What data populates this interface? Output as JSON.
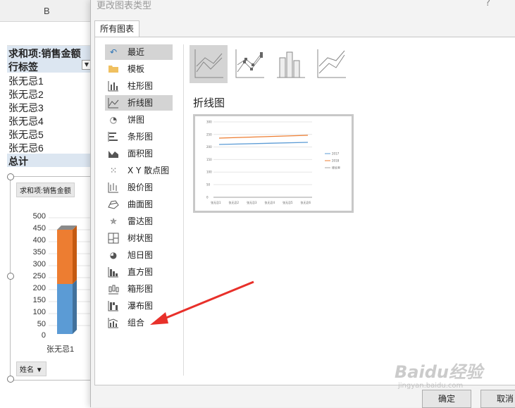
{
  "sheet": {
    "column_header": "B",
    "pivot_title": "求和项:销售金额",
    "row_label": "行标签",
    "rows": [
      "张无忌1",
      "张无忌2",
      "张无忌3",
      "张无忌4",
      "张无忌5",
      "张无忌6"
    ],
    "total": "总计"
  },
  "pivot_chart": {
    "field_button": "求和项:销售金额",
    "axis_button": "姓名",
    "y_ticks": [
      "500",
      "450",
      "400",
      "350",
      "300",
      "250",
      "200",
      "150",
      "100",
      "50",
      "0"
    ],
    "x_label": "张无忌1",
    "x_label_partial": "张",
    "colors": {
      "series1": "#5b9bd5",
      "series2": "#ed7d31"
    }
  },
  "dialog": {
    "title": "更改图表类型",
    "help": "?",
    "tab": "所有图表",
    "categories": [
      {
        "label": "最近",
        "icon": "recent-icon"
      },
      {
        "label": "模板",
        "icon": "folder-icon"
      },
      {
        "label": "柱形图",
        "icon": "column-chart-icon"
      },
      {
        "label": "折线图",
        "icon": "line-chart-icon"
      },
      {
        "label": "饼图",
        "icon": "pie-chart-icon"
      },
      {
        "label": "条形图",
        "icon": "bar-chart-icon"
      },
      {
        "label": "面积图",
        "icon": "area-chart-icon"
      },
      {
        "label": "X Y 散点图",
        "icon": "scatter-chart-icon"
      },
      {
        "label": "股价图",
        "icon": "stock-chart-icon"
      },
      {
        "label": "曲面图",
        "icon": "surface-chart-icon"
      },
      {
        "label": "雷达图",
        "icon": "radar-chart-icon"
      },
      {
        "label": "树状图",
        "icon": "treemap-icon"
      },
      {
        "label": "旭日图",
        "icon": "sunburst-icon"
      },
      {
        "label": "直方图",
        "icon": "histogram-icon"
      },
      {
        "label": "箱形图",
        "icon": "boxplot-icon"
      },
      {
        "label": "瀑布图",
        "icon": "waterfall-icon"
      },
      {
        "label": "组合",
        "icon": "combo-chart-icon"
      }
    ],
    "selected_category": "折线图",
    "preview_title": "折线图",
    "ok": "确定",
    "cancel": "取消"
  },
  "preview_chart": {
    "y_ticks": [
      "300",
      "250",
      "200",
      "150",
      "100",
      "50",
      "0"
    ],
    "categories": [
      "张无忌1",
      "张无忌2",
      "张无忌3",
      "张无忌4",
      "张无忌5",
      "张无忌6"
    ],
    "series": [
      {
        "name": "2017",
        "color": "#5b9bd5"
      },
      {
        "name": "2018",
        "color": "#ed7d31"
      },
      {
        "name": "增长率",
        "color": "#a5a5a5"
      }
    ]
  },
  "annotation": {
    "arrow_color": "#e8302a"
  },
  "watermark": {
    "text": "Baidu经验",
    "sub": "jingyan.baidu.com"
  }
}
